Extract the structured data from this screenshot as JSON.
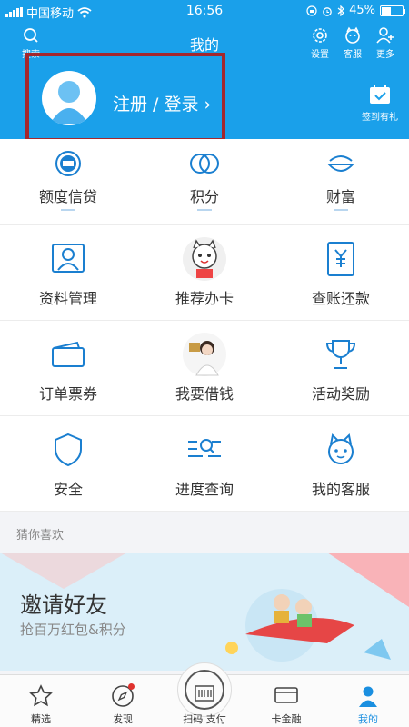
{
  "status": {
    "carrier": "中国移动",
    "time": "16:56",
    "battery": "45%",
    "battery_level": 0.45
  },
  "header": {
    "search": "搜索",
    "title": "我的",
    "actions": [
      {
        "icon": "gear-icon",
        "label": "设置"
      },
      {
        "icon": "customer-service-icon",
        "label": "客服"
      },
      {
        "icon": "add-user-icon",
        "label": "更多"
      }
    ],
    "login": "注册 / 登录 ›",
    "checkin": "签到有礼"
  },
  "grid": {
    "row1": [
      {
        "icon": "credit-icon",
        "label": "额度信贷"
      },
      {
        "icon": "points-icon",
        "label": "积分"
      },
      {
        "icon": "wealth-icon",
        "label": "财富"
      }
    ],
    "rows": [
      [
        {
          "icon": "profile-icon",
          "label": "资料管理"
        },
        {
          "icon": "recommend-card-icon",
          "label": "推荐办卡"
        },
        {
          "icon": "bill-icon",
          "label": "查账还款"
        }
      ],
      [
        {
          "icon": "ticket-icon",
          "label": "订单票券"
        },
        {
          "icon": "loan-icon",
          "label": "我要借钱"
        },
        {
          "icon": "trophy-icon",
          "label": "活动奖励"
        }
      ],
      [
        {
          "icon": "shield-icon",
          "label": "安全"
        },
        {
          "icon": "progress-search-icon",
          "label": "进度查询"
        },
        {
          "icon": "service-mascot-icon",
          "label": "我的客服"
        }
      ]
    ]
  },
  "guess": {
    "title": "猜你喜欢",
    "banner_title": "邀请好友",
    "banner_subtitle": "抢百万红包&积分"
  },
  "tabbar": [
    {
      "icon": "star-icon",
      "label": "精选",
      "active": false
    },
    {
      "icon": "compass-icon",
      "label": "发现",
      "active": false
    },
    {
      "icon": "scan-icon",
      "label": "扫码 支付",
      "active": false
    },
    {
      "icon": "card-icon",
      "label": "卡金融",
      "active": false
    },
    {
      "icon": "person-icon",
      "label": "我的",
      "active": true
    }
  ],
  "colors": {
    "header": "#1aa0ea",
    "accent": "#1a8fe0",
    "highlight_box": "#a4272d"
  }
}
